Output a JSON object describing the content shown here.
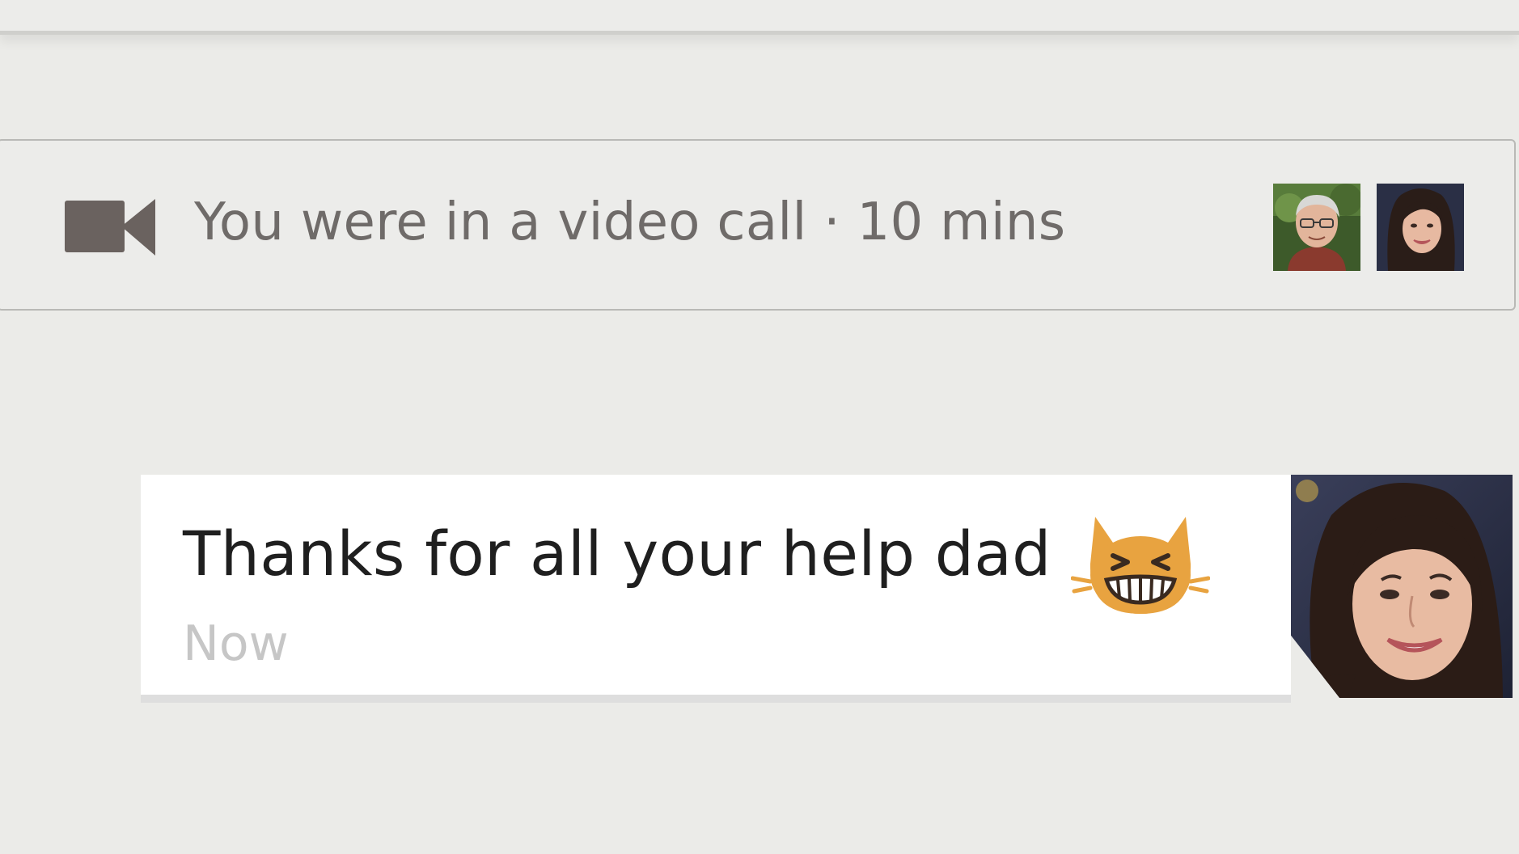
{
  "colors": {
    "background": "#ebebe8",
    "card_border": "#b9b9b6",
    "call_text": "#6f6b69",
    "icon": "#6a625f",
    "message_text": "#1f1f1f",
    "timestamp": "#c6c6c6",
    "emoji_orange": "#e8a340"
  },
  "call_event": {
    "icon": "video-camera-icon",
    "text": "You were in a video call · 10 mins",
    "participants": [
      {
        "name": "participant-1",
        "icon": "avatar-man-glasses"
      },
      {
        "name": "participant-2",
        "icon": "avatar-woman-smiling"
      }
    ]
  },
  "message": {
    "text": "Thanks for all your help dad",
    "emoji": "grinning-cat-icon",
    "timestamp": "Now",
    "sender_avatar": "avatar-woman-smiling"
  }
}
